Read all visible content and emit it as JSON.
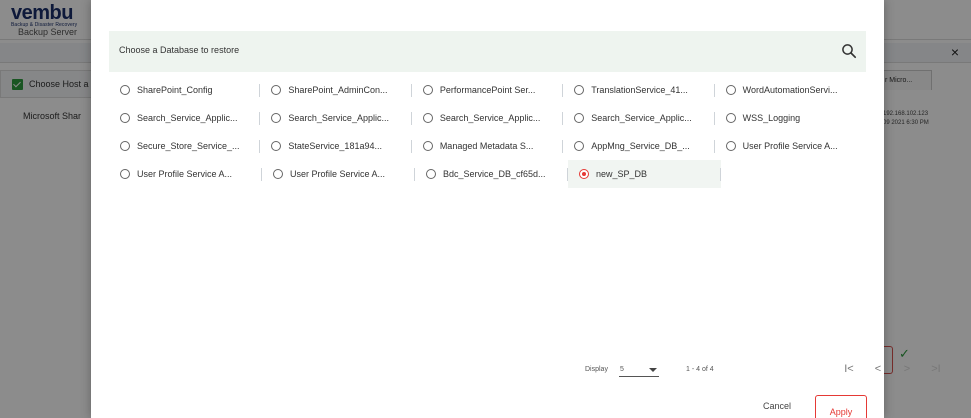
{
  "background": {
    "brand_word": "vembu",
    "brand_tagline": "Backup & Disaster Recovery",
    "sub_title": "Backup Server",
    "choose_host_label": "Choose Host a",
    "row_label": "Microsoft Shar",
    "tab_label": "r Micro...",
    "ip_line1": "192.168.102.123",
    "ip_line2": "09 2021 6:30 PM",
    "close_glyph": "×",
    "tick_glyph": "✓"
  },
  "modal": {
    "search_title": "Choose a Database to restore",
    "databases": [
      [
        {
          "label": "SharePoint_Config",
          "selected": false
        },
        {
          "label": "SharePoint_AdminCon...",
          "selected": false
        },
        {
          "label": "PerformancePoint Ser...",
          "selected": false
        },
        {
          "label": "TranslationService_41...",
          "selected": false
        },
        {
          "label": "WordAutomationServi...",
          "selected": false
        }
      ],
      [
        {
          "label": "Search_Service_Applic...",
          "selected": false
        },
        {
          "label": "Search_Service_Applic...",
          "selected": false
        },
        {
          "label": "Search_Service_Applic...",
          "selected": false
        },
        {
          "label": "Search_Service_Applic...",
          "selected": false
        },
        {
          "label": "WSS_Logging",
          "selected": false
        }
      ],
      [
        {
          "label": "Secure_Store_Service_...",
          "selected": false
        },
        {
          "label": "StateService_181a94...",
          "selected": false
        },
        {
          "label": "Managed Metadata S...",
          "selected": false
        },
        {
          "label": "AppMng_Service_DB_...",
          "selected": false
        },
        {
          "label": "User Profile Service A...",
          "selected": false
        }
      ],
      [
        {
          "label": "User Profile Service A...",
          "selected": false
        },
        {
          "label": "User Profile Service A...",
          "selected": false
        },
        {
          "label": "Bdc_Service_DB_cf65d...",
          "selected": false
        },
        {
          "label": "new_SP_DB",
          "selected": true
        }
      ]
    ],
    "pagination": {
      "display_label": "Display",
      "page_size": "5",
      "range_text": "1 - 4 of 4",
      "first_glyph": "I<",
      "prev_glyph": "<",
      "next_glyph": ">",
      "last_glyph": ">I"
    },
    "cancel_label": "Cancel",
    "apply_label": "Apply"
  },
  "colors": {
    "accent_red": "#e53935",
    "success_green": "#2e9b3e",
    "search_bar_bg": "#eef4ef",
    "brand_navy": "#1a2f6b"
  }
}
